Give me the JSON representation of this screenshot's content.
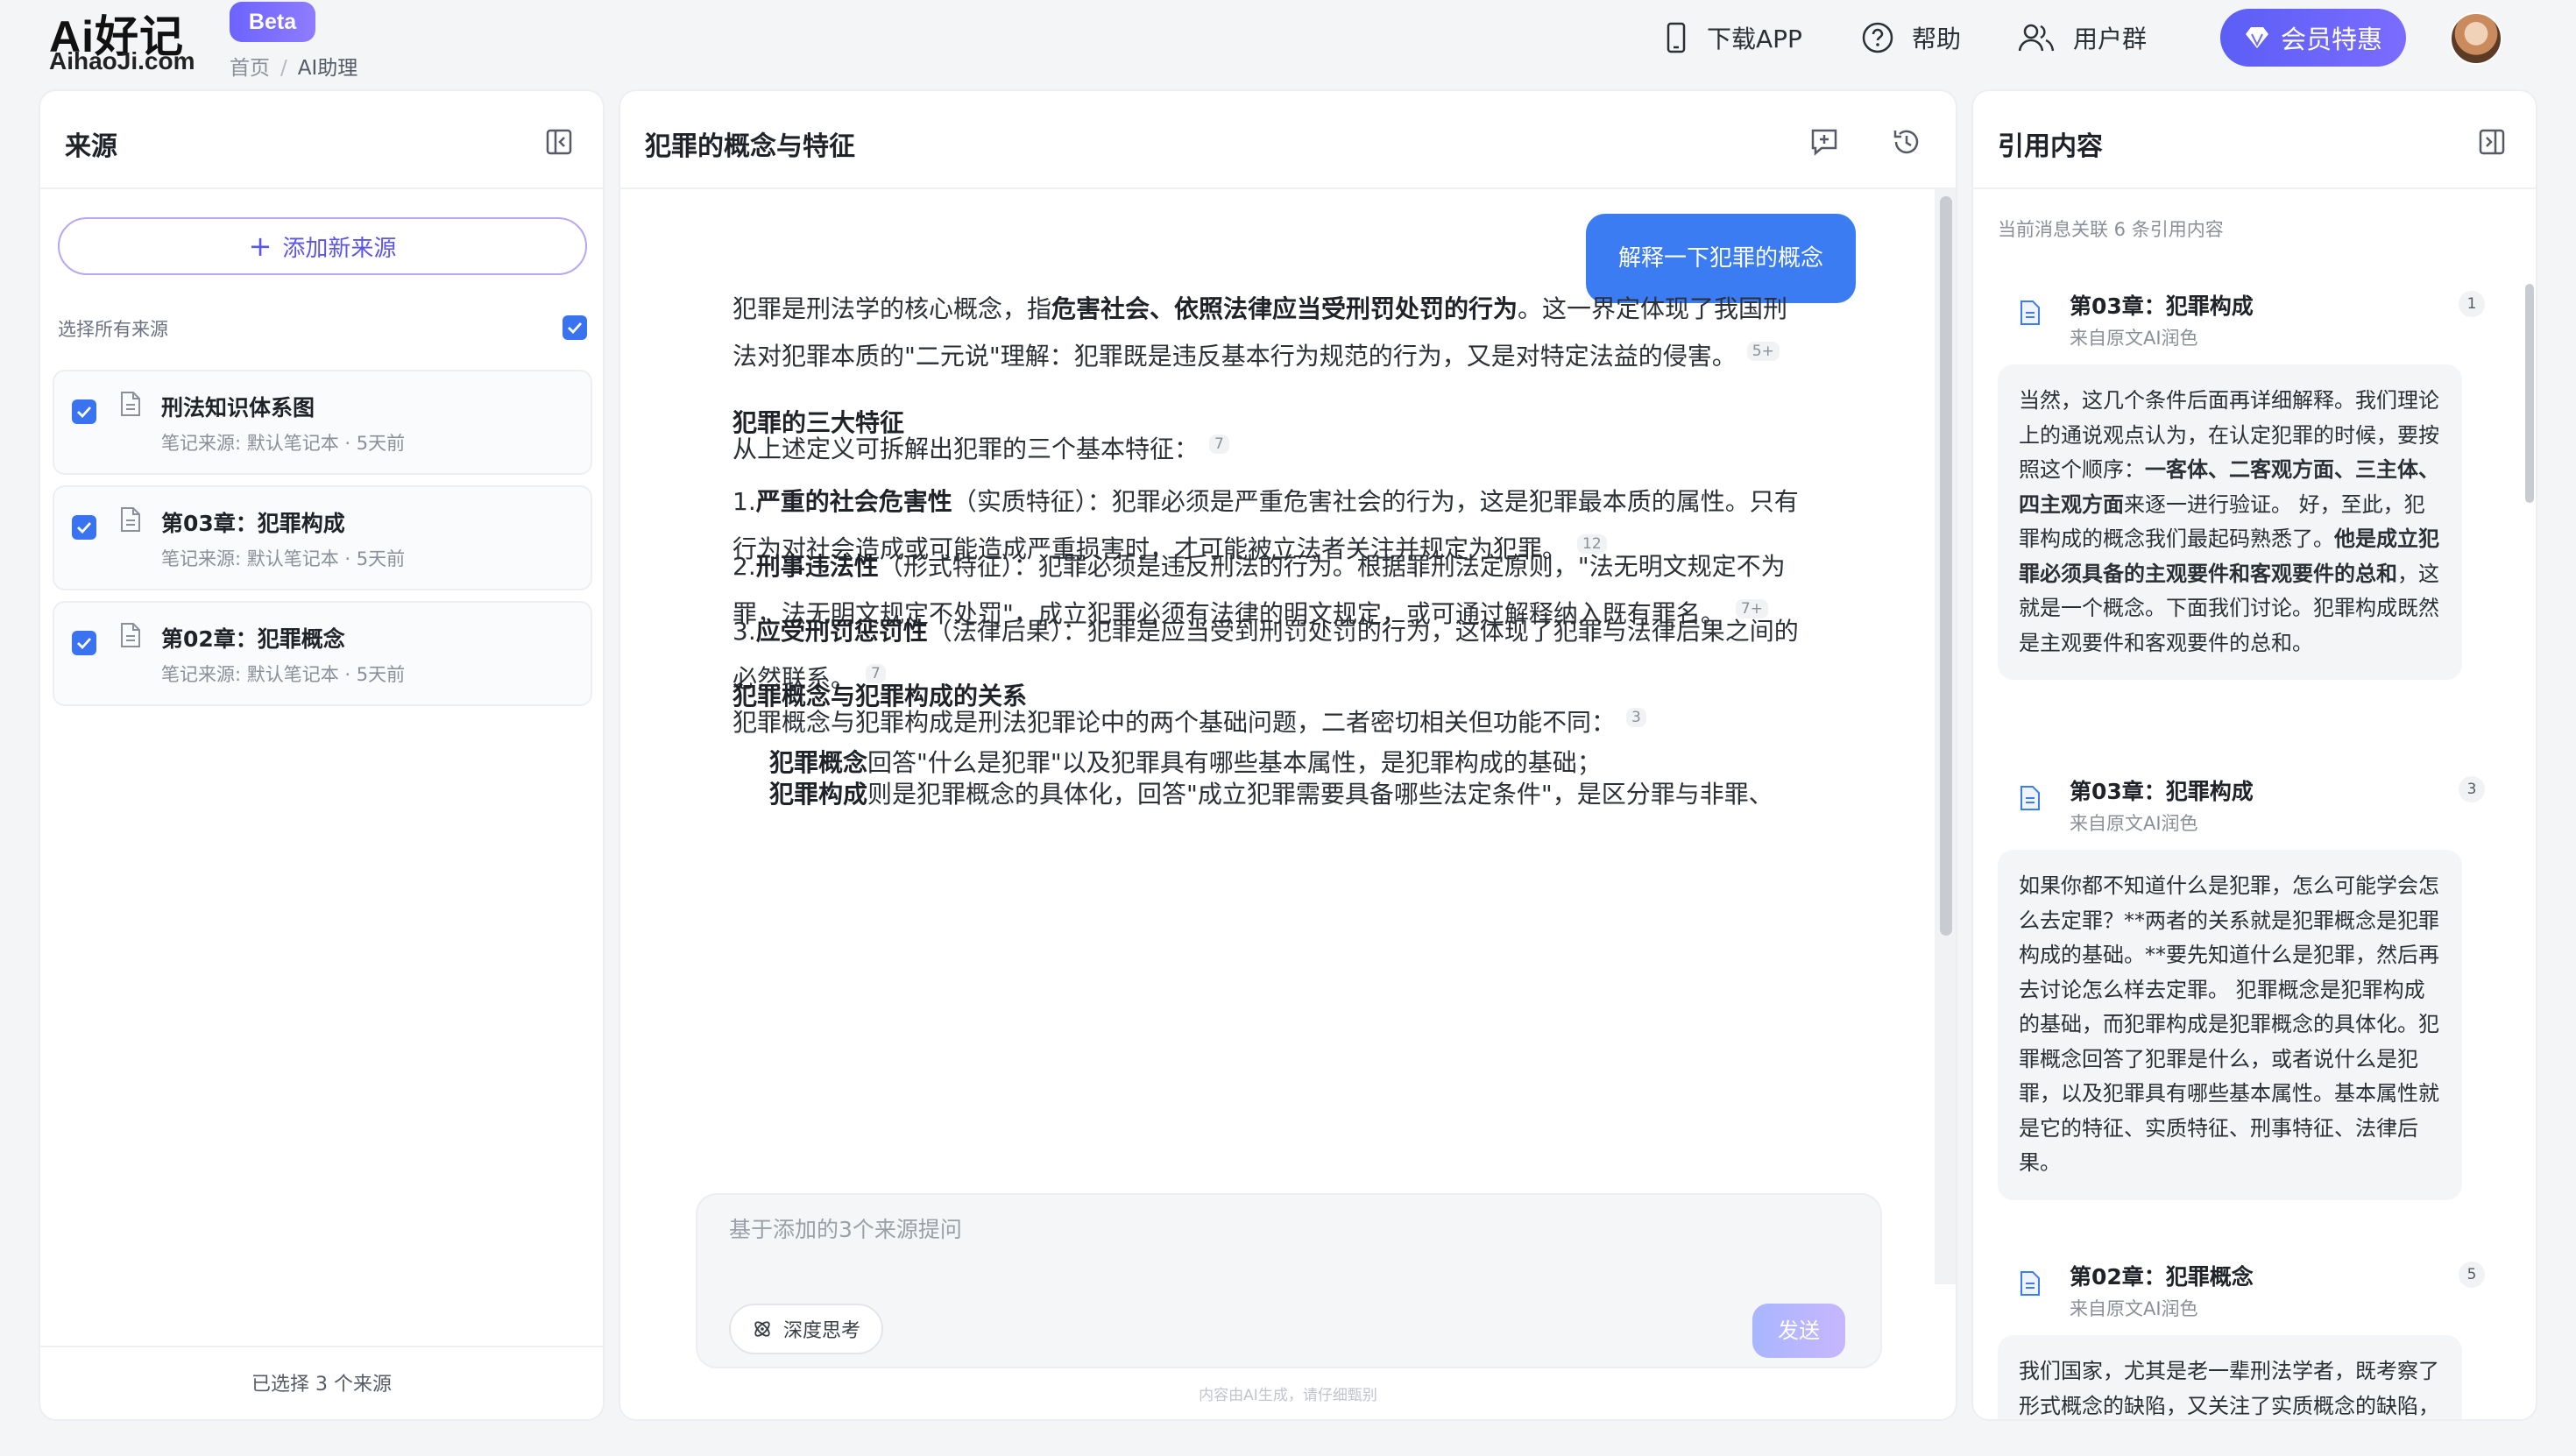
{
  "header": {
    "logo_main": "Ai好记",
    "logo_sub": "AihaoJi.com",
    "beta": "Beta",
    "breadcrumb_home": "首页",
    "breadcrumb_sep": "/",
    "breadcrumb_current": "AI助理",
    "nav_download": "下载APP",
    "nav_help": "帮助",
    "nav_group": "用户群",
    "vip": "会员特惠"
  },
  "left": {
    "title": "来源",
    "add_source": "添加新来源",
    "select_all": "选择所有来源",
    "sources": [
      {
        "title": "刑法知识体系图",
        "meta": "笔记来源: 默认笔记本 · 5天前"
      },
      {
        "title": "第03章：犯罪构成",
        "meta": "笔记来源: 默认笔记本 · 5天前"
      },
      {
        "title": "第02章：犯罪概念",
        "meta": "笔记来源: 默认笔记本 · 5天前"
      }
    ],
    "footer": "已选择 3 个来源"
  },
  "middle": {
    "title": "犯罪的概念与特征",
    "user_message": "解释一下犯罪的概念",
    "answer": {
      "p1_a": "犯罪是刑法学的核心概念，指",
      "p1_b": "危害社会、依照法律应当受刑罚处罚的行为",
      "p1_c": "。这一界定体现了我国刑法对犯罪本质的\"二元说\"理解：犯罪既是违反基本行为规范的行为，又是对特定法益的侵害。",
      "p1_cite": "5+",
      "h1": "犯罪的三大特征",
      "h1_text": "从上述定义可拆解出犯罪的三个基本特征：",
      "h1_cite": "7",
      "f1_n": "1.",
      "f1_b": "严重的社会危害性",
      "f1_t": "（实质特征）：犯罪必须是严重危害社会的行为，这是犯罪最本质的属性。只有行为对社会造成或可能造成严重损害时，才可能被立法者关注并规定为犯罪。",
      "f1_cite": "12",
      "f2_n": "2.",
      "f2_b": "刑事违法性",
      "f2_t": "（形式特征）：犯罪必须是违反刑法的行为。根据罪刑法定原则，\"法无明文规定不为罪，法无明文规定不处罚\"，成立犯罪必须有法律的明文规定，或可通过解释纳入既有罪名。",
      "f2_cite": "7+",
      "f3_n": "3.",
      "f3_b": "应受刑罚惩罚性",
      "f3_t": "（法律后果）：犯罪是应当受到刑罚处罚的行为，这体现了犯罪与法律后果之间的必然联系。",
      "f3_cite": "7",
      "h2": "犯罪概念与犯罪构成的关系",
      "h2_text": "犯罪概念与犯罪构成是刑法犯罪论中的两个基础问题，二者密切相关但功能不同：",
      "h2_cite": "3",
      "r1_b": "犯罪概念",
      "r1_t": "回答\"什么是犯罪\"以及犯罪具有哪些基本属性，是犯罪构成的基础；",
      "r2_b": "犯罪构成",
      "r2_t": "则是犯罪概念的具体化，回答\"成立犯罪需要具备哪些法定条件\"，是区分罪与非罪、"
    },
    "input_placeholder": "基于添加的3个来源提问",
    "deep_think": "深度思考",
    "send": "发送",
    "disclaimer": "内容由AI生成，请仔细甄别"
  },
  "right": {
    "title": "引用内容",
    "count_text": "当前消息关联 6 条引用内容",
    "refs": [
      {
        "title": "第03章：犯罪构成",
        "sub": "来自原文AI润色",
        "num": "1",
        "t1": "当然，这几个条件后面再详细解释。我们理论上的通说观点认为，在认定犯罪的时候，要按照这个顺序：",
        "b1": "一客体、二客观方面、三主体、四主观方面",
        "t2": "来逐一进行验证。 好，至此，犯罪构成的概念我们最起码熟悉了。",
        "b2": "他是成立犯罪必须具备的主观要件和客观要件的总和",
        "t3": "，这就是一个概念。下面我们讨论。犯罪构成既然是主观要件和客观要件的总和。"
      },
      {
        "title": "第03章：犯罪构成",
        "sub": "来自原文AI润色",
        "num": "3",
        "text": "如果你都不知道什么是犯罪，怎么可能学会怎么去定罪？**两者的关系就是犯罪概念是犯罪构成的基础。**要先知道什么是犯罪，然后再去讨论怎么样去定罪。 犯罪概念是犯罪构成的基础，而犯罪构成是犯罪概念的具体化。犯罪概念回答了犯罪是什么，或者说什么是犯罪，以及犯罪具有哪些基本属性。基本属性就是它的特征、实质特征、刑事特征、法律后果。"
      },
      {
        "title": "第02章：犯罪概念",
        "sub": "来自原文AI润色",
        "num": "5",
        "text": "我们国家，尤其是老一辈刑法学者，既考察了形式概念的缺陷，又关注了实质概念的缺陷，"
      }
    ]
  },
  "colors": {
    "accent": "#3b7cf2",
    "brand_purple": "#6c63ff",
    "checkbox": "#3a73f0"
  }
}
